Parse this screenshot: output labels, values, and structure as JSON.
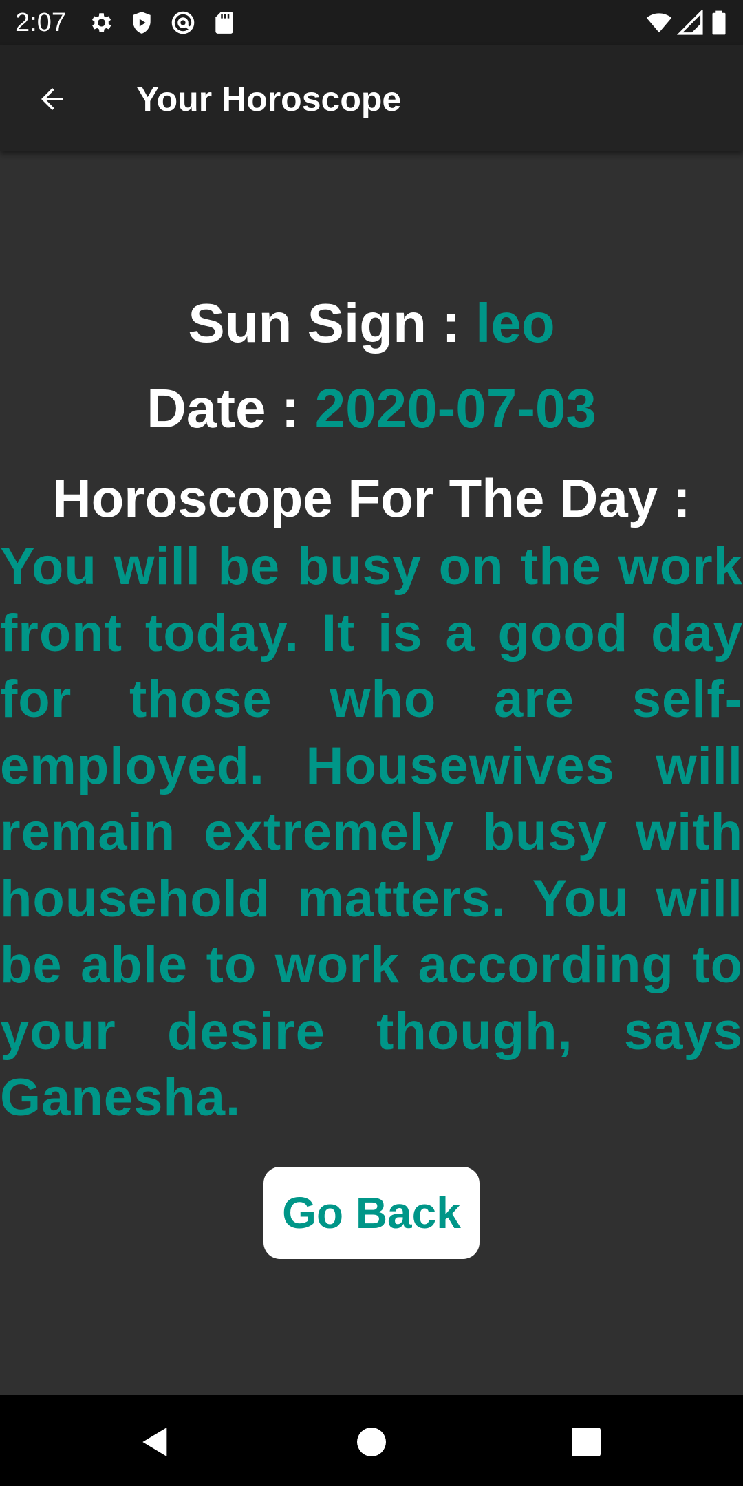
{
  "status_bar": {
    "time": "2:07",
    "icons": [
      "settings-icon",
      "shield-play-icon",
      "at-sign-icon",
      "sd-card-icon",
      "wifi-icon",
      "signal-icon",
      "battery-icon"
    ]
  },
  "app_bar": {
    "title": "Your Horoscope",
    "back_icon": "arrow-back-icon"
  },
  "content": {
    "sun_sign_label": "Sun Sign : ",
    "sun_sign_value": "leo",
    "date_label": "Date : ",
    "date_value": "2020-07-03",
    "horoscope_heading": "Horoscope For The Day :",
    "horoscope_text": "You will be busy on the work front today. It is a good day for those who are self-employed. Housewives will remain extremely busy with household matters. You will be able to work according to your desire though, says Ganesha."
  },
  "go_back_label": "Go Back",
  "nav_bar": {
    "icons": [
      "nav-back-icon",
      "nav-home-icon",
      "nav-recents-icon"
    ]
  },
  "colors": {
    "accent": "#009688",
    "background": "#303030",
    "app_bar": "#232323"
  }
}
